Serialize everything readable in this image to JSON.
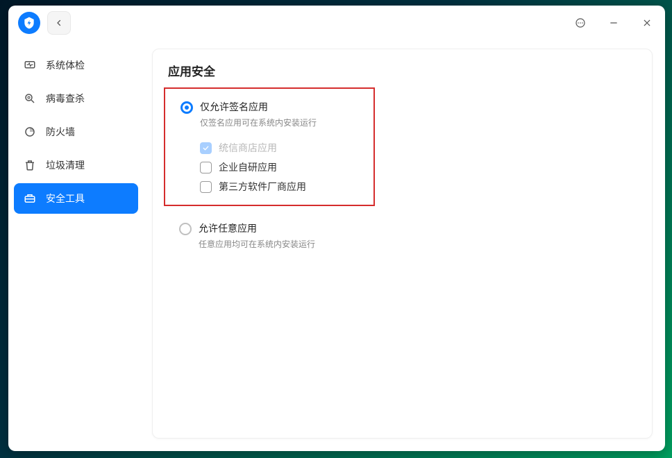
{
  "sidebar": {
    "items": [
      {
        "label": "系统体检"
      },
      {
        "label": "病毒查杀"
      },
      {
        "label": "防火墙"
      },
      {
        "label": "垃圾清理"
      },
      {
        "label": "安全工具"
      }
    ],
    "active_index": 4
  },
  "content": {
    "title": "应用安全",
    "option_signed": {
      "label": "仅允许签名应用",
      "desc": "仅签名应用可在系统内安装运行",
      "selected": true,
      "checkboxes": [
        {
          "label": "统信商店应用",
          "checked": true,
          "disabled": true
        },
        {
          "label": "企业自研应用",
          "checked": false,
          "disabled": false
        },
        {
          "label": "第三方软件厂商应用",
          "checked": false,
          "disabled": false
        }
      ]
    },
    "option_any": {
      "label": "允许任意应用",
      "desc": "任意应用均可在系统内安装运行",
      "selected": false
    }
  }
}
